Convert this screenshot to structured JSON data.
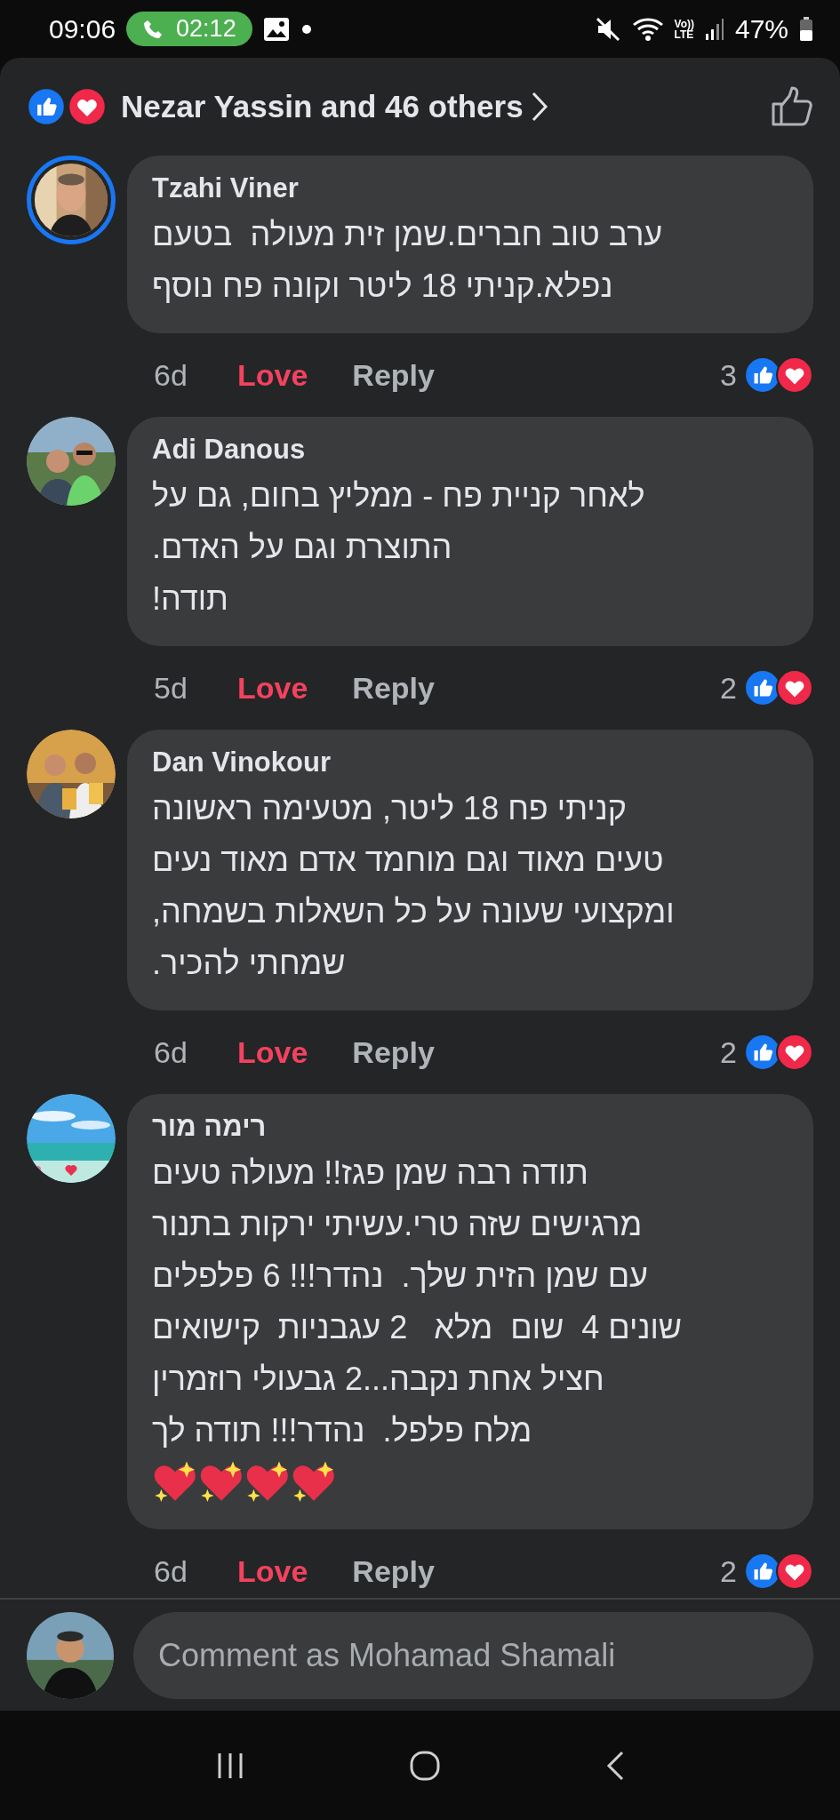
{
  "status_bar": {
    "time": "09:06",
    "call_timer": "02:12",
    "network_top": "Vo))",
    "network_bottom": "LTE",
    "battery": "47%"
  },
  "reactions_summary": {
    "text": "Nezar Yassin and 46 others"
  },
  "comments": [
    {
      "author": "Tzahi Viner",
      "story": true,
      "text": "ערב טוב חברים.שמן זית מעולה  בטעם\nנפלא.קניתי 18 ליטר וקונה פח נוסף",
      "time": "6d",
      "love_label": "Love",
      "loved": true,
      "reply_label": "Reply",
      "reaction_count": "3"
    },
    {
      "author": "Adi Danous",
      "story": false,
      "text": "לאחר קניית פח - ממליץ בחום, גם על\nהתוצרת וגם על האדם.\nתודה!",
      "time": "5d",
      "love_label": "Love",
      "loved": true,
      "reply_label": "Reply",
      "reaction_count": "2"
    },
    {
      "author": "Dan Vinokour",
      "story": false,
      "text": "קניתי פח 18 ליטר, מטעימה ראשונה\nטעים מאוד וגם מוחמד אדם מאוד נעים\nומקצועי שעונה על כל השאלות בשמחה,\nשמחתי להכיר.",
      "time": "6d",
      "love_label": "Love",
      "loved": true,
      "reply_label": "Reply",
      "reaction_count": "2"
    },
    {
      "author": "רימה מור",
      "story": false,
      "text": "תודה רבה שמן פגז!! מעולה טעים\nמרגישים שזה טרי.עשיתי ירקות בתנור\nעם שמן הזית שלך.  נהדר!!! 6 פלפלים\nשונים 4  שום  מלא   2 עגבניות  קישואים\nחציל אחת נקבה...2 גבעולי רוזמרין\nמלח פלפל.  נהדר!!! תודה לך",
      "emoji": [
        {
          "kind": "sparkling-heart"
        },
        {
          "kind": "sparkling-heart"
        },
        {
          "kind": "sparkling-heart"
        },
        {
          "kind": "sparkling-heart"
        }
      ],
      "time": "6d",
      "love_label": "Love",
      "loved": true,
      "reply_label": "Reply",
      "reaction_count": "2"
    }
  ],
  "composer": {
    "placeholder": "Comment as Mohamad Shamali"
  }
}
